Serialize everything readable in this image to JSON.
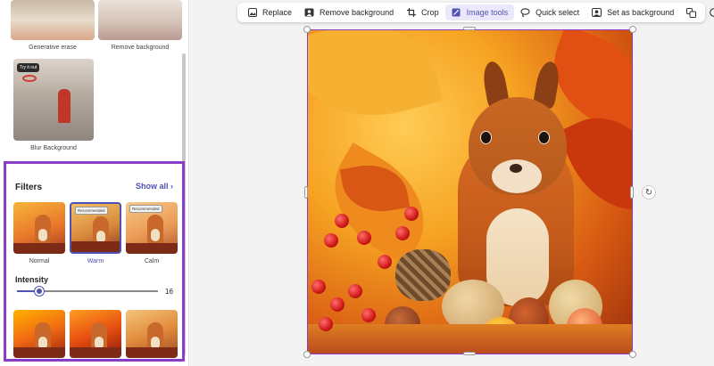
{
  "panel": {
    "effects": [
      {
        "label": "Generative erase"
      },
      {
        "label": "Remove background"
      },
      {
        "label": "Blur Background",
        "badge": "Try it out"
      }
    ],
    "filters": {
      "title": "Filters",
      "show_all": "Show all",
      "items": [
        {
          "label": "Normal",
          "badge": ""
        },
        {
          "label": "Warm",
          "badge": "Recommended",
          "selected": true
        },
        {
          "label": "Calm",
          "badge": "Recommended"
        }
      ],
      "intensity": {
        "label": "Intensity",
        "value": "16",
        "fraction": 0.16
      }
    }
  },
  "toolbar": {
    "items": [
      {
        "label": "Replace",
        "icon": "image-icon"
      },
      {
        "label": "Remove background",
        "icon": "person-icon"
      },
      {
        "label": "Crop",
        "icon": "crop-icon"
      },
      {
        "label": "Image tools",
        "icon": "magic-icon",
        "active": true
      },
      {
        "label": "Quick select",
        "icon": "lasso-icon"
      },
      {
        "label": "Set as background",
        "icon": "background-icon"
      }
    ],
    "extra_icons": [
      "copy-icon",
      "contrast-icon"
    ]
  },
  "colors": {
    "accent": "#4f52b2",
    "highlight": "#8a3ec8"
  }
}
